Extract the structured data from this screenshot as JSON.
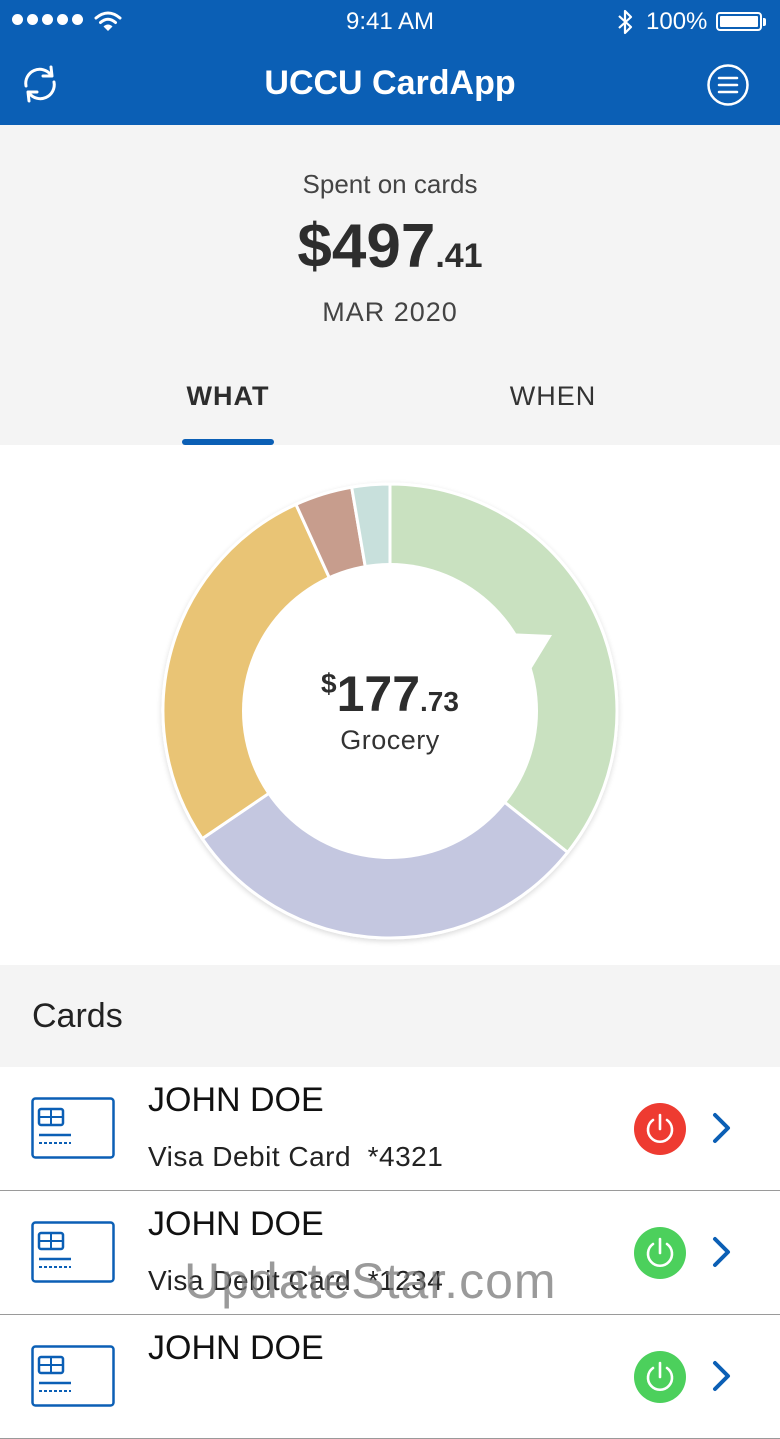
{
  "status_bar": {
    "time": "9:41 AM",
    "battery": "100%"
  },
  "nav": {
    "title": "UCCU CardApp",
    "refresh_icon": "refresh-icon",
    "menu_icon": "menu-icon"
  },
  "summary": {
    "label": "Spent on cards",
    "amount_whole": "$497",
    "amount_cents": ".41",
    "period": "MAR 2020"
  },
  "tabs": [
    {
      "label": "WHAT",
      "active": true
    },
    {
      "label": "WHEN",
      "active": false
    }
  ],
  "chart_data": {
    "type": "pie",
    "style": "donut",
    "selected": {
      "currency": "$",
      "amount_whole": "177",
      "amount_cents": ".73",
      "category": "Grocery"
    },
    "segments": [
      {
        "color": "#c9e1c0",
        "fraction": 0.357
      },
      {
        "color": "#c4c7e0",
        "fraction": 0.298
      },
      {
        "color": "#e9c474",
        "fraction": 0.277
      },
      {
        "color": "#c79d8d",
        "fraction": 0.041
      },
      {
        "color": "#c8e0dc",
        "fraction": 0.027
      }
    ]
  },
  "cards": {
    "header": "Cards",
    "items": [
      {
        "name": "JOHN DOE",
        "type": "Visa Debit Card",
        "number": "*4321",
        "status": "off",
        "status_color": "#ee3b31"
      },
      {
        "name": "JOHN DOE",
        "type": "Visa Debit Card",
        "number": "*1234",
        "status": "on",
        "status_color": "#4cd05c"
      },
      {
        "name": "JOHN DOE",
        "type": "",
        "number": "",
        "status": "on",
        "status_color": "#4cd05c"
      }
    ]
  },
  "colors": {
    "brand": "#0b5fb5",
    "background_light": "#f4f4f4"
  },
  "watermark": "UpdateStar.com"
}
